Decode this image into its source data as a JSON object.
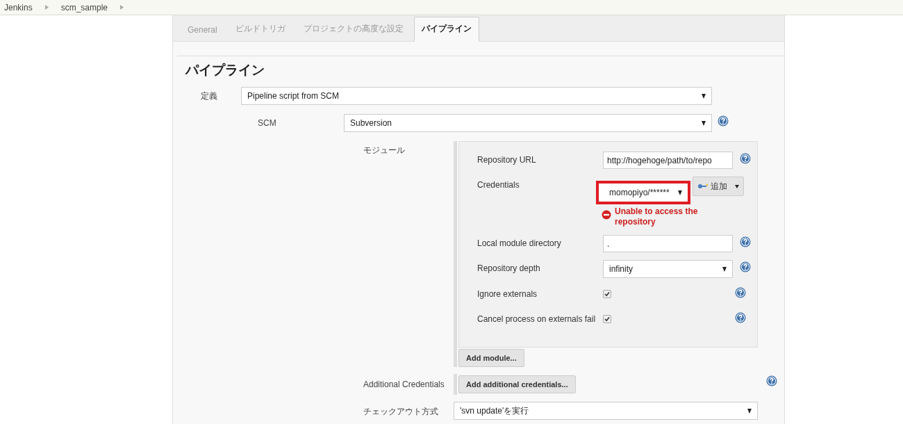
{
  "breadcrumbs": [
    "Jenkins",
    "scm_sample"
  ],
  "tabs": [
    {
      "label": "General",
      "selected": false
    },
    {
      "label": "ビルドトリガ",
      "selected": false
    },
    {
      "label": "プロジェクトの高度な設定",
      "selected": false
    },
    {
      "label": "パイプライン",
      "selected": true
    }
  ],
  "section_title": "パイプライン",
  "definition": {
    "label": "定義",
    "value": "Pipeline script from SCM"
  },
  "scm": {
    "label": "SCM",
    "value": "Subversion"
  },
  "modules": {
    "label": "モジュール",
    "rows": [
      {
        "kind": "text",
        "label": "Repository URL",
        "value": "http://hogehoge/path/to/repo"
      },
      {
        "kind": "credentials",
        "label": "Credentials",
        "value": "momopiyo/******",
        "highlighted": true,
        "add_label": "追加",
        "error": "Unable to access the repository"
      },
      {
        "kind": "text",
        "label": "Local module directory",
        "value": "."
      },
      {
        "kind": "select",
        "label": "Repository depth",
        "value": "infinity"
      },
      {
        "kind": "checkbox",
        "label": "Ignore externals",
        "checked": true
      },
      {
        "kind": "checkbox",
        "label": "Cancel process on externals fail",
        "checked": true
      }
    ],
    "add_button": "Add module..."
  },
  "additional_credentials": {
    "label": "Additional Credentials",
    "button": "Add additional credentials..."
  },
  "checkout": {
    "label": "チェックアウト方式",
    "value": "'svn update'を実行"
  }
}
